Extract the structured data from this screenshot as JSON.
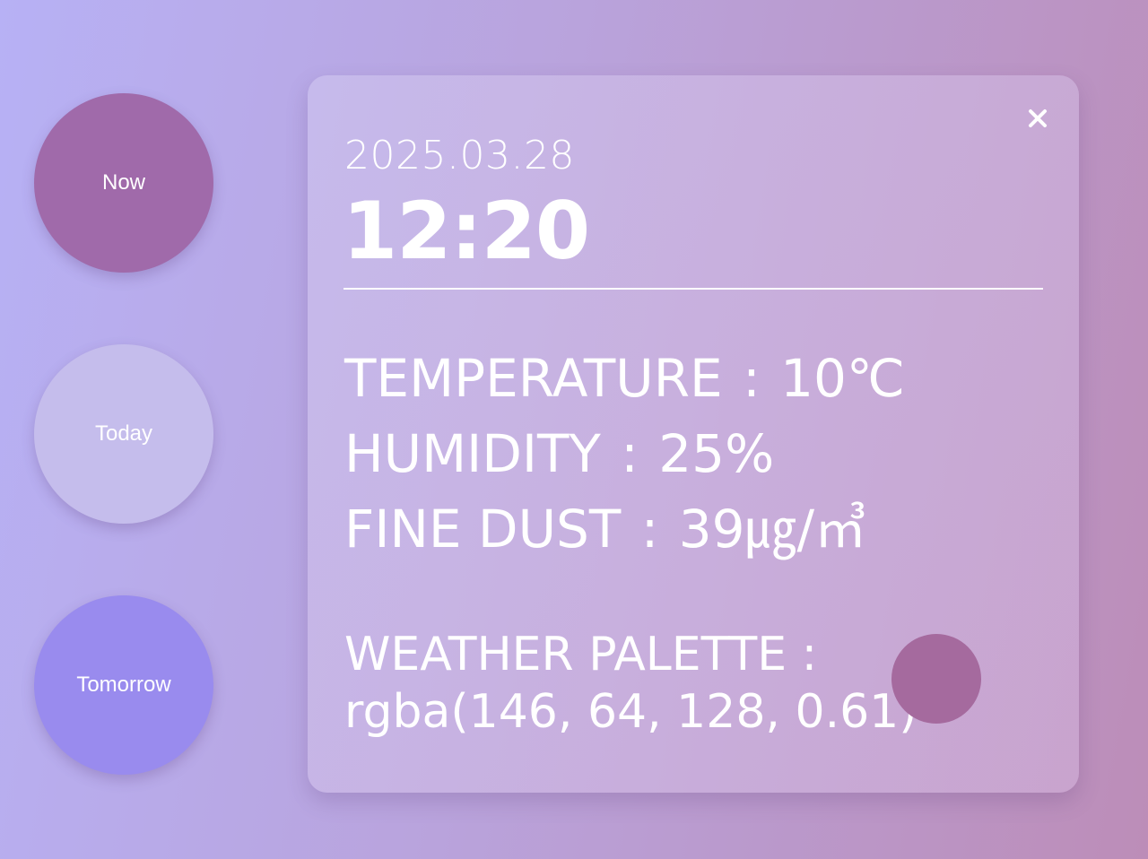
{
  "tabs": {
    "now": {
      "label": "Now"
    },
    "today": {
      "label": "Today"
    },
    "tomorrow": {
      "label": "Tomorrow"
    }
  },
  "card": {
    "close_icon": "close-icon",
    "date": "2025.03.28",
    "time": "12:20",
    "temperature": {
      "label": "TEMPERATURE",
      "separator": ":",
      "value": "10℃"
    },
    "humidity": {
      "label": "HUMIDITY",
      "separator": ":",
      "value": "25%"
    },
    "fine_dust": {
      "label": "FINE DUST",
      "separator": ":",
      "value": "39㎍/㎥"
    },
    "palette": {
      "label": "WEATHER PALETTE :",
      "value": "rgba(146, 64, 128, 0.61)",
      "swatch_color": "#a56a9e"
    }
  },
  "colors": {
    "now_tab": "#a06aaa",
    "today_tab": "#c5bdec",
    "tomorrow_tab": "#998bee"
  }
}
